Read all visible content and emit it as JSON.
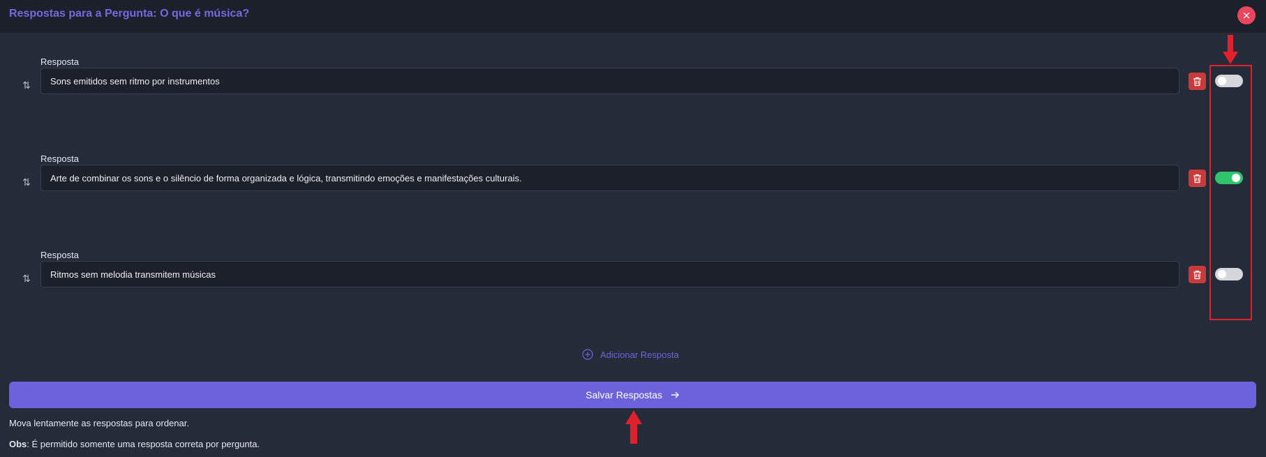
{
  "header": {
    "title": "Respostas para a Pergunta: O que é música?",
    "close_label": "×"
  },
  "answers": [
    {
      "label": "Resposta",
      "value": "Sons emitidos sem ritmo por instrumentos",
      "correct": false
    },
    {
      "label": "Resposta",
      "value": "Arte de combinar os sons e o silêncio de forma organizada e lógica, transmitindo emoções e manifestações culturais.",
      "correct": true
    },
    {
      "label": "Resposta",
      "value": "Ritmos sem melodia transmitem músicas",
      "correct": false
    }
  ],
  "add_answer_label": "Adicionar Resposta",
  "save_button_label": "Salvar Respostas",
  "help_text": "Mova lentamente as respostas para ordenar.",
  "obs": {
    "prefix": "Obs",
    "text": ": É permitido somente uma resposta correta por pergunta."
  },
  "colors": {
    "accent": "#6c63dc",
    "toggle_on": "#2ec56d",
    "delete": "#c93a3a",
    "close": "#e8455f",
    "annotation": "#e0202a"
  },
  "icons": {
    "drag": "sort-arrows-icon",
    "delete": "trash-icon",
    "add": "plus-circle-icon",
    "save": "arrow-right-icon",
    "close": "close-icon"
  }
}
